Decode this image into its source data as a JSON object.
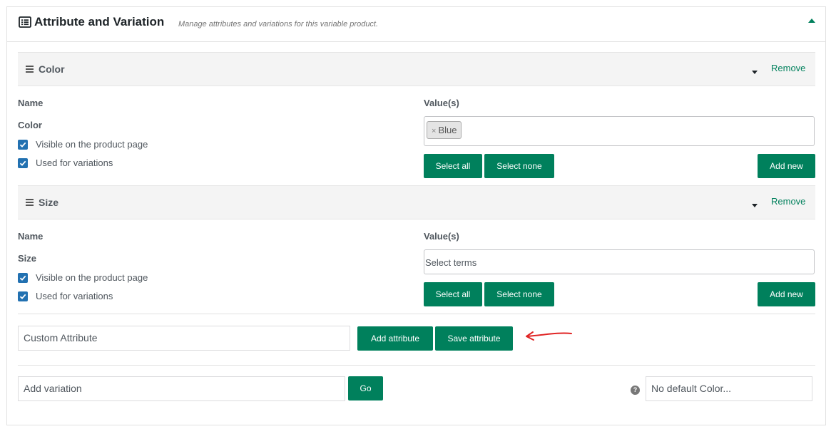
{
  "header": {
    "title": "Attribute and Variation",
    "subtitle": "Manage attributes and variations for this variable product.",
    "icon": "list-icon",
    "collapse_icon": "caret-up-icon"
  },
  "attributes": [
    {
      "bar_title": "Color",
      "remove_label": "Remove",
      "name_label": "Name",
      "name_value": "Color",
      "values_label": "Value(s)",
      "selected_terms": [
        "Blue"
      ],
      "placeholder": "",
      "visible_label": "Visible on the product page",
      "visible_checked": true,
      "variations_label": "Used for variations",
      "variations_checked": true,
      "select_all_label": "Select all",
      "select_none_label": "Select none",
      "add_new_label": "Add new"
    },
    {
      "bar_title": "Size",
      "remove_label": "Remove",
      "name_label": "Name",
      "name_value": "Size",
      "values_label": "Value(s)",
      "selected_terms": [],
      "placeholder": "Select terms",
      "visible_label": "Visible on the product page",
      "visible_checked": true,
      "variations_label": "Used for variations",
      "variations_checked": true,
      "select_all_label": "Select all",
      "select_none_label": "Select none",
      "add_new_label": "Add new"
    }
  ],
  "custom_attribute": {
    "select_value": "Custom Attribute",
    "add_attribute_label": "Add attribute",
    "save_attribute_label": "Save attribute"
  },
  "variation": {
    "select_value": "Add variation",
    "go_label": "Go",
    "default_select_value": "No default Color...",
    "help_icon_glyph": "?"
  },
  "colors": {
    "accent": "#00805c",
    "checkbox": "#2271b1",
    "annotation_arrow": "#e02424"
  }
}
